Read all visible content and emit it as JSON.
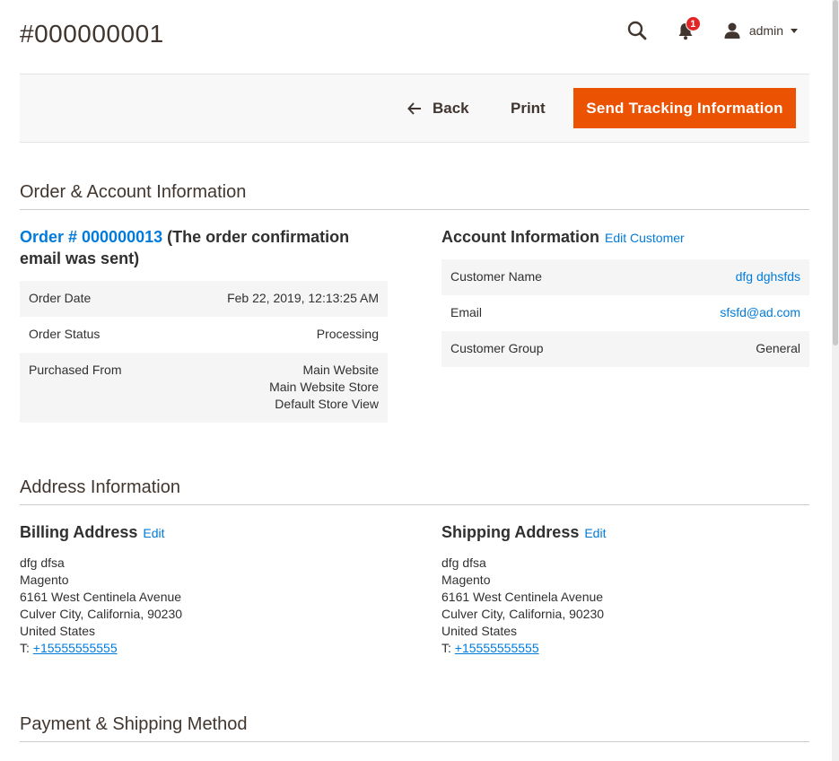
{
  "page": {
    "title": "#000000001"
  },
  "header": {
    "search_icon": "search-icon",
    "notifications_count": "1",
    "username": "admin"
  },
  "actions": {
    "back_label": "Back",
    "print_label": "Print",
    "primary_label": "Send Tracking Information"
  },
  "order_account": {
    "section_title": "Order & Account Information",
    "order_link": "Order # 000000013",
    "order_note": " (The order confirmation email was sent)",
    "order_rows": [
      {
        "label": "Order Date",
        "value": "Feb 22, 2019, 12:13:25 AM"
      },
      {
        "label": "Order Status",
        "value": "Processing"
      },
      {
        "label": "Purchased From",
        "value_lines": [
          "Main Website",
          "Main Website Store",
          "Default Store View"
        ]
      }
    ],
    "account_title": "Account Information",
    "account_edit": "Edit Customer",
    "account_rows": [
      {
        "label": "Customer Name",
        "value": "dfg dghsfds"
      },
      {
        "label": "Email",
        "value": "sfsfd@ad.com"
      },
      {
        "label": "Customer Group",
        "value": "General"
      }
    ]
  },
  "address_info": {
    "section_title": "Address Information",
    "billing": {
      "title": "Billing Address",
      "edit": "Edit",
      "name": "dfg dfsa",
      "company": "Magento",
      "street": "6161 West Centinela Avenue",
      "city_line": "Culver City, California, 90230",
      "country": "United States",
      "phone_prefix": "T: ",
      "phone": "+15555555555"
    },
    "shipping": {
      "title": "Shipping Address",
      "edit": "Edit",
      "name": "dfg dfsa",
      "company": "Magento",
      "street": "6161 West Centinela Avenue",
      "city_line": "Culver City, California, 90230",
      "country": "United States",
      "phone_prefix": "T: ",
      "phone": "+15555555555"
    }
  },
  "payment_shipping": {
    "section_title": "Payment & Shipping Method"
  }
}
